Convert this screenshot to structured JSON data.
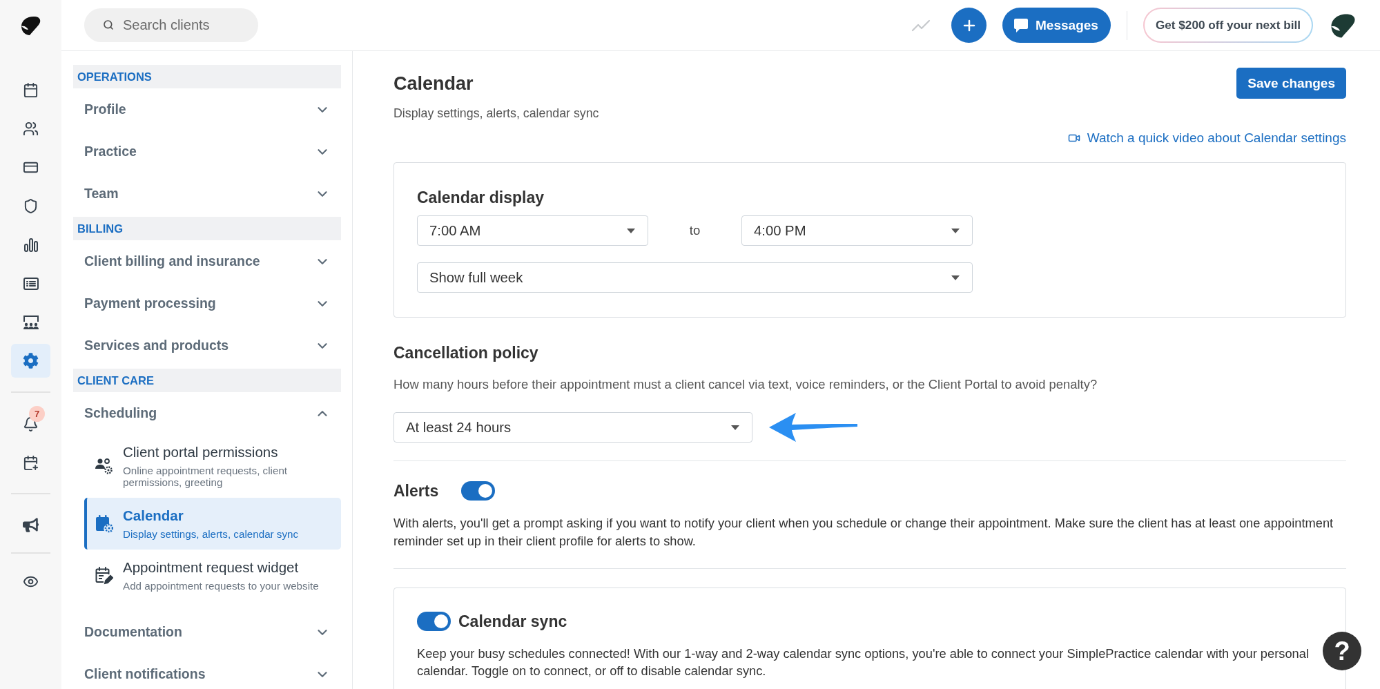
{
  "rail": {
    "groups": [
      {
        "items": [
          {
            "selected": false
          },
          {
            "selected": false
          },
          {
            "selected": false
          },
          {
            "selected": false
          },
          {
            "selected": false
          },
          {
            "selected": false
          },
          {
            "selected": false
          },
          {
            "selected": true
          }
        ]
      },
      {
        "items": [
          {
            "selected": false,
            "badge": "7"
          },
          {
            "selected": false
          }
        ]
      },
      {
        "items": [
          {
            "selected": false
          }
        ]
      },
      {
        "items": [
          {
            "selected": false
          }
        ]
      }
    ]
  },
  "top_bar": {
    "search": {
      "placeholder": "Search clients"
    },
    "messages_button": "Messages",
    "promo_button": "Get $200 off your next bill"
  },
  "sidebar": {
    "sections": [
      {
        "heading": "OPERATIONS",
        "items": [
          {
            "label": "Profile",
            "expanded": false
          },
          {
            "label": "Practice",
            "expanded": false
          },
          {
            "label": "Team",
            "expanded": false
          }
        ]
      },
      {
        "heading": "BILLING",
        "items": [
          {
            "label": "Client billing and insurance",
            "expanded": false
          },
          {
            "label": "Payment processing",
            "expanded": false
          },
          {
            "label": "Services and products",
            "expanded": false
          }
        ]
      },
      {
        "heading": "CLIENT CARE",
        "items": [
          {
            "label": "Scheduling",
            "expanded": true,
            "children": [
              {
                "title": "Client portal permissions",
                "description": "Online appointment requests, client permissions, greeting",
                "selected": false
              },
              {
                "title": "Calendar",
                "description": "Display settings, alerts, calendar sync",
                "selected": true
              },
              {
                "title": "Appointment request widget",
                "description": "Add appointment requests to your website",
                "selected": false
              }
            ]
          },
          {
            "label": "Documentation",
            "expanded": false
          },
          {
            "label": "Client notifications",
            "expanded": false
          }
        ]
      }
    ]
  },
  "main": {
    "title": "Calendar",
    "subtitle": "Display settings, alerts, calendar sync",
    "save_button": "Save changes",
    "video_link": "Watch a quick video about Calendar settings",
    "calendar_display": {
      "heading": "Calendar display",
      "start_time": "7:00 AM",
      "separator": "to",
      "end_time": "4:00 PM",
      "week_view": "Show full week"
    },
    "cancellation_policy": {
      "heading": "Cancellation policy",
      "question": "How many hours before their appointment must a client cancel via text, voice reminders, or the Client Portal to avoid penalty?",
      "value": "At least 24 hours"
    },
    "alerts": {
      "heading": "Alerts",
      "on": true,
      "description": "With alerts, you'll get a prompt asking if you want to notify your client when you schedule or change their appointment. Make sure the client has at least one appointment reminder set up in their client profile for alerts to show."
    },
    "calendar_sync": {
      "heading": "Calendar sync",
      "on": true,
      "description": "Keep your busy schedules connected! With our 1-way and 2-way calendar sync options, you're able to connect your SimplePractice calendar with your personal calendar. Toggle on to connect, or off to disable calendar sync."
    }
  },
  "help_button": "?"
}
